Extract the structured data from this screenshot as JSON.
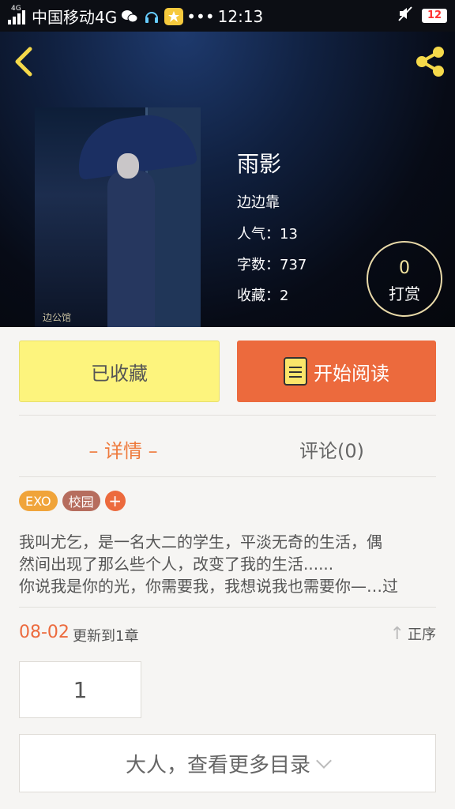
{
  "status_bar": {
    "network_tag": "4G",
    "carrier": "中国移动4G",
    "time": "12:13",
    "dots": "•••",
    "battery": "12"
  },
  "book": {
    "title": "雨影",
    "author": "边边靠",
    "popularity": "人气：13",
    "word_count": "字数：737",
    "favorites": "收藏：2",
    "cover_watermark": "边公馆"
  },
  "tip": {
    "count": "0",
    "label": "打赏"
  },
  "actions": {
    "collected_label": "已收藏",
    "read_label": "开始阅读"
  },
  "tabs": {
    "details": "– 详情 –",
    "comments": "评论(0)"
  },
  "tags": [
    "EXO",
    "校园"
  ],
  "tag_add": "+",
  "synopsis": [
    "我叫尤乞，是一名大二的学生，平淡无奇的生活，偶",
    "然间出现了那么些个人，改变了我的生活......",
    "你说我是你的光，你需要我，我想说我也需要你—…过"
  ],
  "update": {
    "date": "08-02",
    "text": "更新到1章",
    "sort_label": "正序"
  },
  "chapters": [
    "1"
  ],
  "more_label": "大人，查看更多目录",
  "colors": {
    "accent": "#ec6a3d",
    "collected": "#fdf47d",
    "header_bg": "#070b16"
  }
}
